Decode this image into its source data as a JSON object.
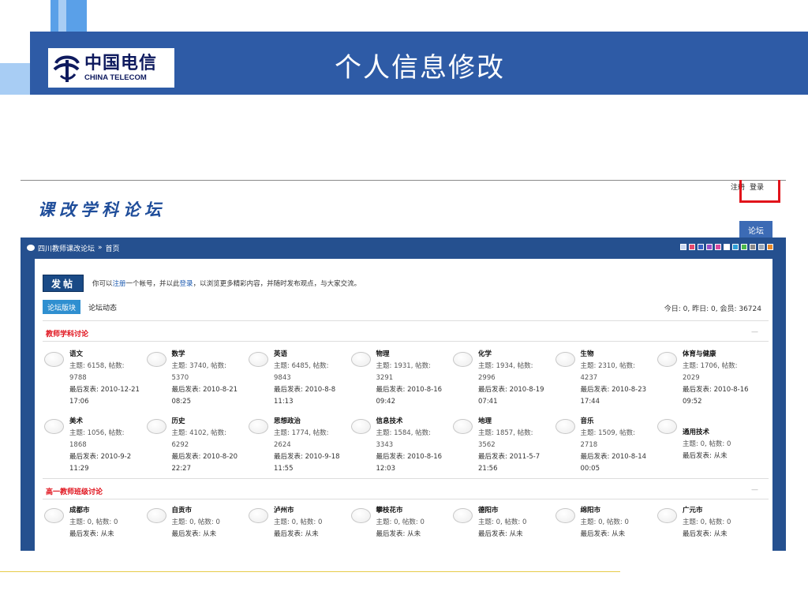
{
  "slide": {
    "title": "个人信息修改",
    "logo_cn": "中国电信",
    "logo_en": "CHINA TELECOM"
  },
  "top_links": {
    "register": "注册",
    "login": "登录"
  },
  "forum": {
    "logo": "课改学科论坛",
    "nav_tab": "论坛",
    "breadcrumb": {
      "site": "四川教师课改论坛",
      "sep": "»",
      "home": "首页"
    },
    "swatches": [
      "#c9d7f0",
      "#e64a6e",
      "#3a62c4",
      "#9b4fc7",
      "#d94a9e",
      "#ffffff",
      "#2e9fd8",
      "#4cb84c",
      "#8a8a8a",
      "#9aa6b5",
      "#e88a2a"
    ],
    "post_button": "发帖",
    "notice": {
      "p1": "你可以",
      "register": "注册",
      "p2": "一个帐号，并以此",
      "login": "登录",
      "p3": "，以浏览更多精彩内容，并随时发布观点，与大家交流。"
    },
    "tab_boards": "论坛版块",
    "tab_activity": "论坛动态",
    "stats": "今日: 0, 昨日: 0, 会员: 36724",
    "sections": [
      {
        "title": "教师学科讨论",
        "dash": "—",
        "boards": [
          {
            "name": "语文",
            "stats": "主题: 6158, 帖数: 9788",
            "last": "最后发表: 2010-12-21 17:06"
          },
          {
            "name": "数学",
            "stats": "主题: 3740, 帖数: 5370",
            "last": "最后发表: 2010-8-21 08:25"
          },
          {
            "name": "英语",
            "stats": "主题: 6485, 帖数: 9843",
            "last": "最后发表: 2010-8-8 11:13"
          },
          {
            "name": "物理",
            "stats": "主题: 1931, 帖数: 3291",
            "last": "最后发表: 2010-8-16 09:42"
          },
          {
            "name": "化学",
            "stats": "主题: 1934, 帖数: 2996",
            "last": "最后发表: 2010-8-19 07:41"
          },
          {
            "name": "生物",
            "stats": "主题: 2310, 帖数: 4237",
            "last": "最后发表: 2010-8-23 17:44"
          },
          {
            "name": "体育与健康",
            "stats": "主题: 1706, 帖数: 2029",
            "last": "最后发表: 2010-8-16 09:52"
          },
          {
            "name": "美术",
            "stats": "主题: 1056, 帖数: 1868",
            "last": "最后发表: 2010-9-2 11:29"
          },
          {
            "name": "历史",
            "stats": "主题: 4102, 帖数: 6292",
            "last": "最后发表: 2010-8-20 22:27"
          },
          {
            "name": "思想政治",
            "stats": "主题: 1774, 帖数: 2624",
            "last": "最后发表: 2010-9-18 11:55"
          },
          {
            "name": "信息技术",
            "stats": "主题: 1584, 帖数: 3343",
            "last": "最后发表: 2010-8-16 12:03"
          },
          {
            "name": "地理",
            "stats": "主题: 1857, 帖数: 3562",
            "last": "最后发表: 2011-5-7 21:56"
          },
          {
            "name": "音乐",
            "stats": "主题: 1509, 帖数: 2718",
            "last": "最后发表: 2010-8-14 00:05"
          },
          {
            "name": "通用技术",
            "stats": "主题: 0, 帖数: 0",
            "last": "最后发表: 从未"
          }
        ]
      },
      {
        "title": "高一教师班级讨论",
        "dash": "—",
        "boards": [
          {
            "name": "成都市",
            "stats": "主题: 0, 帖数: 0",
            "last": "最后发表: 从未"
          },
          {
            "name": "自贡市",
            "stats": "主题: 0, 帖数: 0",
            "last": "最后发表: 从未"
          },
          {
            "name": "泸州市",
            "stats": "主题: 0, 帖数: 0",
            "last": "最后发表: 从未"
          },
          {
            "name": "攀枝花市",
            "stats": "主题: 0, 帖数: 0",
            "last": "最后发表: 从未"
          },
          {
            "name": "德阳市",
            "stats": "主题: 0, 帖数: 0",
            "last": "最后发表: 从未"
          },
          {
            "name": "绵阳市",
            "stats": "主题: 0, 帖数: 0",
            "last": "最后发表: 从未"
          },
          {
            "name": "广元市",
            "stats": "主题: 0, 帖数: 0",
            "last": "最后发表: 从未"
          }
        ]
      }
    ]
  }
}
